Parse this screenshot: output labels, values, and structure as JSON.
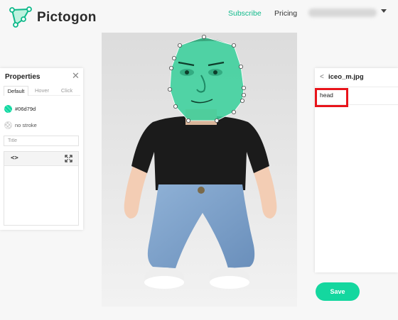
{
  "app": {
    "brand": "Pictogon",
    "accent": "#0fb98a"
  },
  "nav": {
    "subscribe": "Subscribe",
    "pricing": "Pricing",
    "account_icon": "chevron-down-icon"
  },
  "properties": {
    "title": "Properties",
    "close_icon": "close-icon",
    "tabs": [
      "Default",
      "Hover",
      "Click"
    ],
    "active_tab": "Default",
    "fill_color": "#06d79d",
    "fill_label": "#06d79d",
    "stroke_label": "no stroke",
    "title_placeholder": "Title",
    "code_icon": "code-icon",
    "expand_icon": "expand-icon"
  },
  "right_panel": {
    "back_icon": "chevron-left-icon",
    "file_name": "iceo_m.jpg",
    "shapes": [
      {
        "name": "head",
        "highlighted": true,
        "highlight_color": "#e8141b"
      }
    ]
  },
  "save_label": "Save",
  "save_color": "#14d79f"
}
